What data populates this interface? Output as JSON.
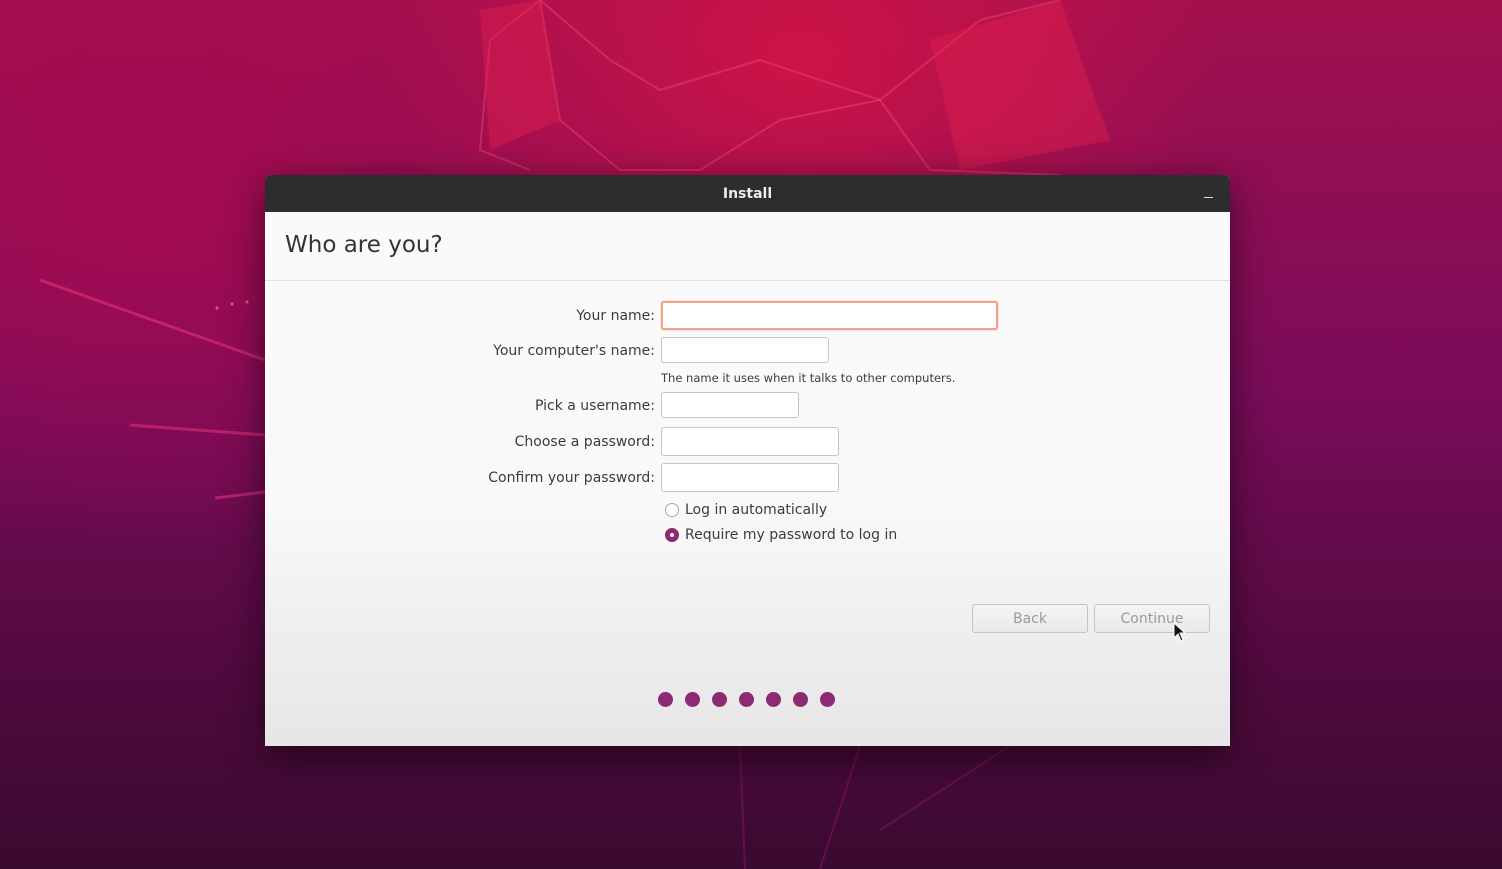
{
  "window": {
    "title": "Install"
  },
  "page": {
    "heading": "Who are you?"
  },
  "form": {
    "name_label": "Your name:",
    "name_value": "",
    "computer_label": "Your computer's name:",
    "computer_value": "",
    "computer_hint": "The name it uses when it talks to other computers.",
    "username_label": "Pick a username:",
    "username_value": "",
    "password_label": "Choose a password:",
    "password_value": "",
    "confirm_label": "Confirm your password:",
    "confirm_value": "",
    "login_options": [
      {
        "label": "Log in automatically",
        "selected": false
      },
      {
        "label": "Require my password to log in",
        "selected": true
      }
    ]
  },
  "buttons": {
    "back": "Back",
    "continue": "Continue"
  },
  "progress": {
    "steps": 7,
    "accent_color": "#8c2a73"
  },
  "icons": {
    "minimize": "minimize-icon",
    "cursor": "mouse-pointer-icon"
  }
}
